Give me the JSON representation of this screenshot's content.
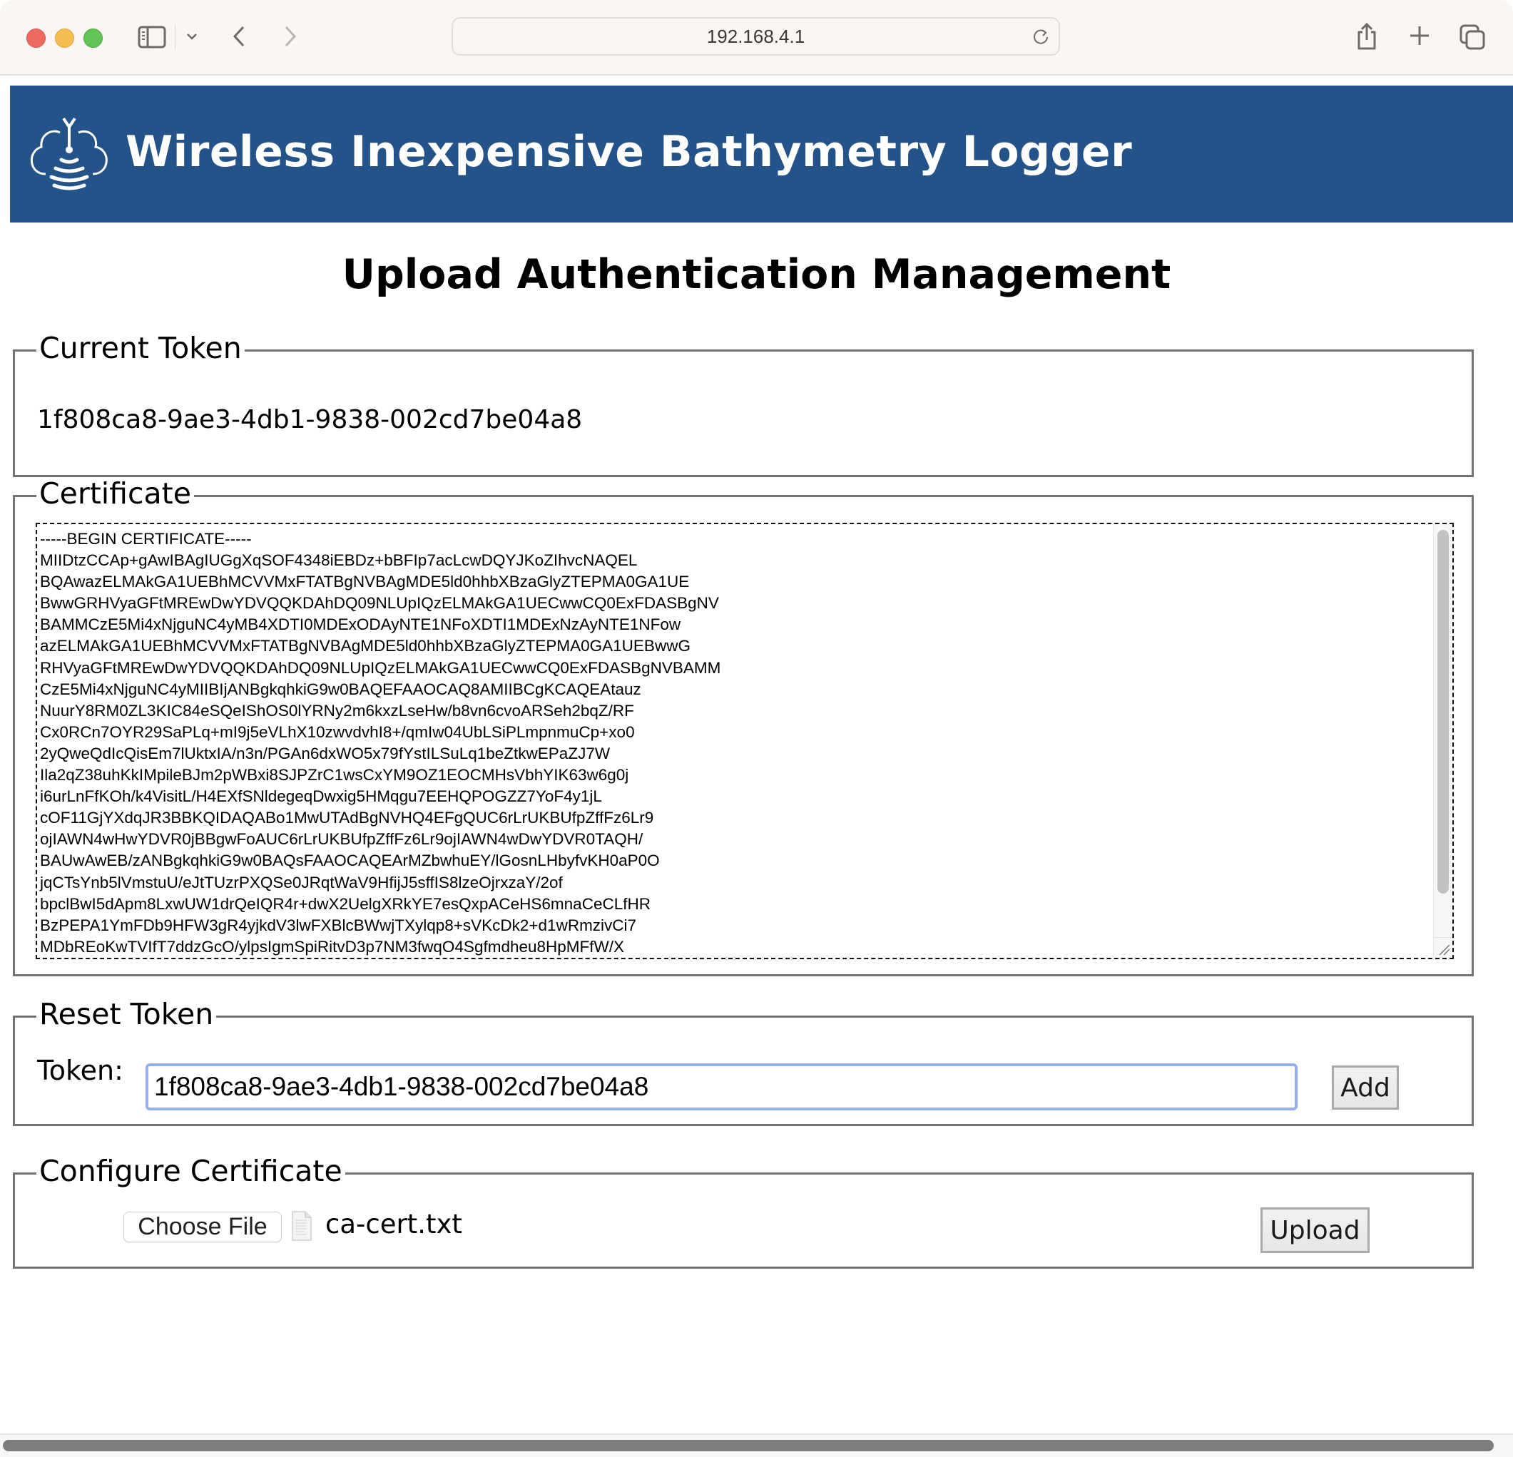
{
  "browser": {
    "url": "192.168.4.1",
    "icons": {
      "sidebar": "sidebar-icon",
      "chevron": "chevron-down-icon",
      "back": "chevron-left-icon",
      "forward": "chevron-right-icon",
      "reload": "reload-icon",
      "share": "share-icon",
      "new_tab": "plus-icon",
      "tabs": "tab-overview-icon"
    }
  },
  "banner": {
    "title": "Wireless Inexpensive Bathymetry Logger",
    "logo": "wireless-sonar-cloud-logo",
    "background": "#245389"
  },
  "page": {
    "heading": "Upload Authentication Management"
  },
  "current_token": {
    "legend": "Current Token",
    "value": "1f808ca8-9ae3-4db1-9838-002cd7be04a8"
  },
  "certificate": {
    "legend": "Certificate",
    "lines": [
      "-----BEGIN CERTIFICATE-----",
      "MIIDtzCCAp+gAwIBAgIUGgXqSOF4348iEBDz+bBFIp7acLcwDQYJKoZIhvcNAQEL",
      "BQAwazELMAkGA1UEBhMCVVMxFTATBgNVBAgMDE5ld0hhbXBzaGlyZTEPMA0GA1UE",
      "BwwGRHVyaGFtMREwDwYDVQQKDAhDQ09NLUpIQzELMAkGA1UECwwCQ0ExFDASBgNV",
      "BAMMCzE5Mi4xNjguNC4yMB4XDTI0MDExODAyNTE1NFoXDTI1MDExNzAyNTE1NFow",
      "azELMAkGA1UEBhMCVVMxFTATBgNVBAgMDE5ld0hhbXBzaGlyZTEPMA0GA1UEBwwG",
      "RHVyaGFtMREwDwYDVQQKDAhDQ09NLUpIQzELMAkGA1UECwwCQ0ExFDASBgNVBAMM",
      "CzE5Mi4xNjguNC4yMIIBIjANBgkqhkiG9w0BAQEFAAOCAQ8AMIIBCgKCAQEAtauz",
      "NuurY8RM0ZL3KIC84eSQeIShOS0lYRNy2m6kxzLseHw/b8vn6cvoARSeh2bqZ/RF",
      "Cx0RCn7OYR29SaPLq+mI9j5eVLhX10zwvdvhI8+/qmIw04UbLSiPLmpnmuCp+xo0",
      "2yQweQdIcQisEm7lUktxIA/n3n/PGAn6dxWO5x79fYstILSuLq1beZtkwEPaZJ7W",
      "Ila2qZ38uhKkIMpileBJm2pWBxi8SJPZrC1wsCxYM9OZ1EOCMHsVbhYIK63w6g0j",
      "i6urLnFfKOh/k4VisitL/H4EXfSNldegeqDwxig5HMqgu7EEHQPOGZZ7YoF4y1jL",
      "cOF11GjYXdqJR3BBKQIDAQABo1MwUTAdBgNVHQ4EFgQUC6rLrUKBUfpZffFz6Lr9",
      "ojIAWN4wHwYDVR0jBBgwFoAUC6rLrUKBUfpZffFz6Lr9ojIAWN4wDwYDVR0TAQH/",
      "BAUwAwEB/zANBgkqhkiG9w0BAQsFAAOCAQEArMZbwhuEY/lGosnLHbyfvKH0aP0O",
      "jqCTsYnb5lVmstuU/eJtTUzrPXQSe0JRqtWaV9HfijJ5sffIS8lzeOjrxzaY/2of",
      "bpclBwI5dApm8LxwUW1drQeIQR4r+dwX2UelgXRkYE7esQxpACeHS6mnaCeCLfHR",
      "BzPEPA1YmFDb9HFW3gR4yjkdV3lwFXBlcBWwjTXylqp8+sVKcDk2+d1wRmzivCi7",
      "MDbREoKwTVIfT7ddzGcO/ylpsIgmSpiRitvD3p7NM3fwqO4Sgfmdheu8HpMFfW/X"
    ],
    "scroll_position": "top"
  },
  "reset_token": {
    "legend": "Reset Token",
    "label": "Token:",
    "input_value": "1f808ca8-9ae3-4db1-9838-002cd7be04a8",
    "add_label": "Add"
  },
  "configure_certificate": {
    "legend": "Configure Certificate",
    "choose_file_label": "Choose File",
    "file_icon": "document-icon",
    "file_name": "ca-cert.txt",
    "upload_label": "Upload"
  }
}
